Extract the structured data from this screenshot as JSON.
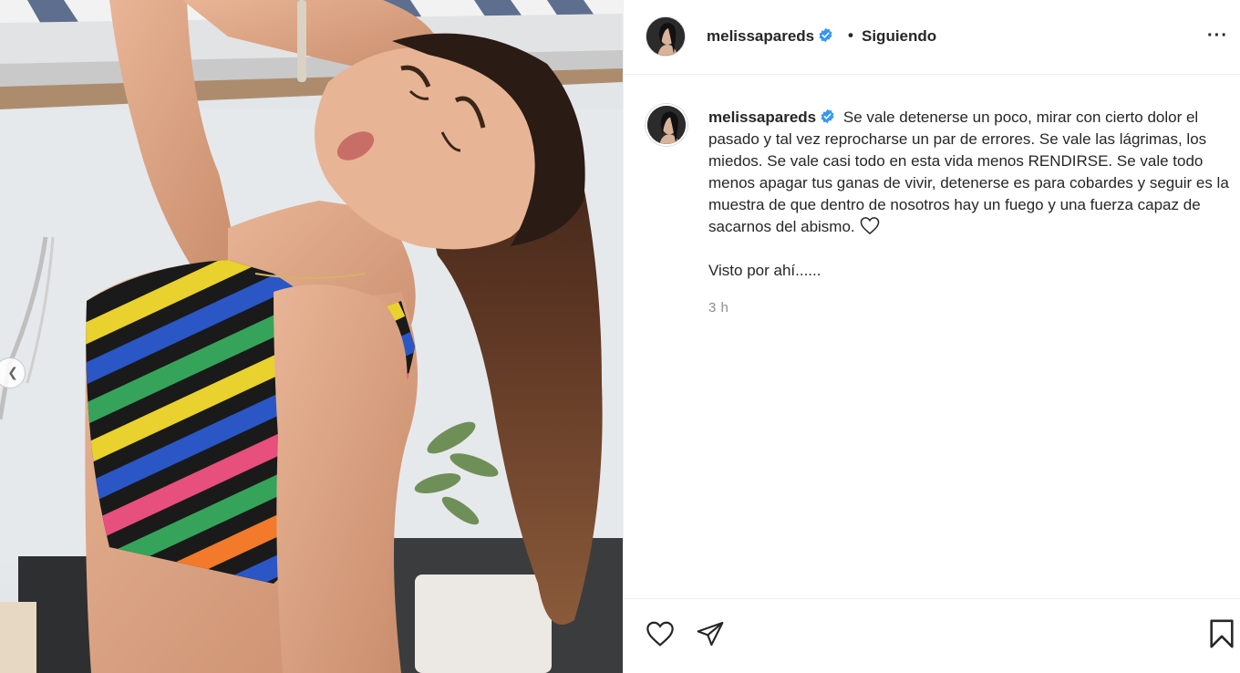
{
  "post": {
    "username": "melissapareds",
    "verified": true,
    "follow_separator": "•",
    "follow_status": "Siguiendo",
    "more_icon": "more-options-icon"
  },
  "caption": {
    "username": "melissapareds",
    "text": "Se vale detenerse un poco, mirar con cierto dolor el pasado y tal vez reprocharse un par de errores. Se vale las lágrimas, los miedos. Se vale casi todo en esta vida menos RENDIRSE. Se vale todo menos apagar tus ganas de vivir, detenerse es para cobardes y seguir es la muestra de que dentro de nosotros hay un fuego y una fuerza capaz de sacarnos del abismo.",
    "emoji_icon": "white-heart-icon",
    "extra": "Visto por ahí......",
    "timestamp": "3 h"
  },
  "actions": {
    "like_icon": "heart-icon",
    "share_icon": "paper-plane-icon",
    "save_icon": "bookmark-icon"
  },
  "photo": {
    "prev_icon": "chevron-left-icon"
  },
  "colors": {
    "text": "#262626",
    "muted": "#8e8e8e",
    "verified_blue": "#3897f0",
    "border": "#efefef"
  }
}
